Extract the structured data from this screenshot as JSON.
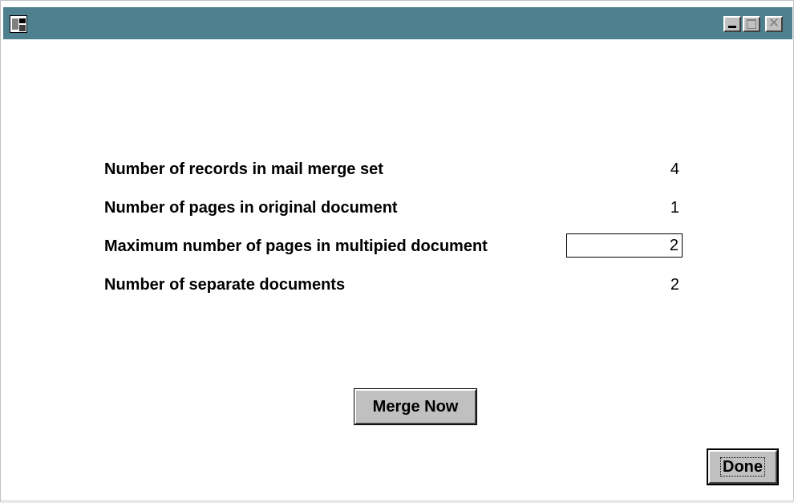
{
  "window": {
    "title": ""
  },
  "rows": [
    {
      "label": "Number of records in mail merge set",
      "value": "4"
    },
    {
      "label": "Number of pages in original document",
      "value": "1"
    },
    {
      "label": "Maximum number of pages in multipied document",
      "value": "2"
    },
    {
      "label": "Number of separate documents",
      "value": "2"
    }
  ],
  "buttons": {
    "merge_now": "Merge Now",
    "done": "Done"
  },
  "controls": {
    "close_glyph": "✕"
  }
}
